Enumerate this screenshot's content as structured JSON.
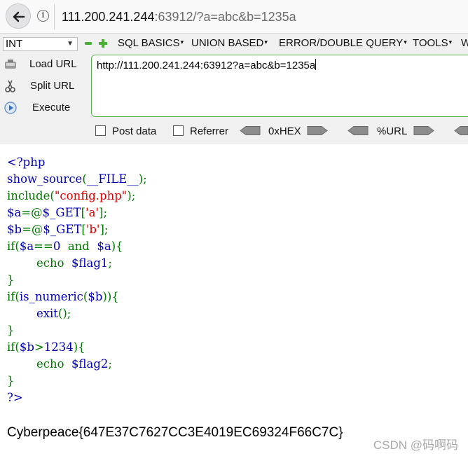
{
  "address_bar": {
    "url_host": "111.200.241.244",
    "url_rest": ":63912/?a=abc&b=1235a"
  },
  "hackbar": {
    "type_select": "INT",
    "menus": [
      "SQL BASICS",
      "UNION BASED",
      "ERROR/DOUBLE QUERY",
      "TOOLS",
      "W"
    ],
    "buttons": {
      "load_url": "Load URL",
      "split_url": "Split URL",
      "execute": "Execute"
    },
    "url_value": "http://111.200.241.244:63912?a=abc&b=1235a",
    "post_data_label": "Post data",
    "referrer_label": "Referrer",
    "hex_label": "0xHEX",
    "url_label": "%URL",
    "post_data_checked": false,
    "referrer_checked": false,
    "accent_color": "#58b34a"
  },
  "code": [
    [
      {
        "t": "<?php",
        "c": "d"
      }
    ],
    [
      {
        "t": "show_source",
        "c": "d"
      },
      {
        "t": "(",
        "c": "k"
      },
      {
        "t": "__FILE__",
        "c": "d"
      },
      {
        "t": ");",
        "c": "k"
      }
    ],
    [
      {
        "t": "include(",
        "c": "k"
      },
      {
        "t": "\"config.php\"",
        "c": "s"
      },
      {
        "t": ");",
        "c": "k"
      }
    ],
    [
      {
        "t": "$a",
        "c": "d"
      },
      {
        "t": "=@",
        "c": "k"
      },
      {
        "t": "$_GET",
        "c": "d"
      },
      {
        "t": "[",
        "c": "k"
      },
      {
        "t": "'a'",
        "c": "s"
      },
      {
        "t": "];",
        "c": "k"
      }
    ],
    [
      {
        "t": "$b",
        "c": "d"
      },
      {
        "t": "=@",
        "c": "k"
      },
      {
        "t": "$_GET",
        "c": "d"
      },
      {
        "t": "[",
        "c": "k"
      },
      {
        "t": "'b'",
        "c": "s"
      },
      {
        "t": "];",
        "c": "k"
      }
    ],
    [
      {
        "t": "if(",
        "c": "k"
      },
      {
        "t": "$a",
        "c": "d"
      },
      {
        "t": "==",
        "c": "k"
      },
      {
        "t": "0  ",
        "c": "d"
      },
      {
        "t": "and  ",
        "c": "k"
      },
      {
        "t": "$a",
        "c": "d"
      },
      {
        "t": "){",
        "c": "k"
      }
    ],
    [
      {
        "t": "        echo  ",
        "c": "k"
      },
      {
        "t": "$flag1",
        "c": "d"
      },
      {
        "t": ";",
        "c": "k"
      }
    ],
    [
      {
        "t": "}",
        "c": "k"
      }
    ],
    [
      {
        "t": "if(",
        "c": "k"
      },
      {
        "t": "is_numeric",
        "c": "d"
      },
      {
        "t": "(",
        "c": "k"
      },
      {
        "t": "$b",
        "c": "d"
      },
      {
        "t": ")){",
        "c": "k"
      }
    ],
    [
      {
        "t": "        exit",
        "c": "d"
      },
      {
        "t": "();",
        "c": "k"
      }
    ],
    [
      {
        "t": "}",
        "c": "k"
      }
    ],
    [
      {
        "t": "if(",
        "c": "k"
      },
      {
        "t": "$b",
        "c": "d"
      },
      {
        "t": ">",
        "c": "k"
      },
      {
        "t": "1234",
        "c": "d"
      },
      {
        "t": "){",
        "c": "k"
      }
    ],
    [
      {
        "t": "        echo  ",
        "c": "k"
      },
      {
        "t": "$flag2",
        "c": "d"
      },
      {
        "t": ";",
        "c": "k"
      }
    ],
    [
      {
        "t": "}",
        "c": "k"
      }
    ],
    [
      {
        "t": "?>",
        "c": "d"
      }
    ]
  ],
  "flag_output": "Cyberpeace{647E37C7627CC3E4019EC69324F66C7C}",
  "watermark": "CSDN @码啊码"
}
